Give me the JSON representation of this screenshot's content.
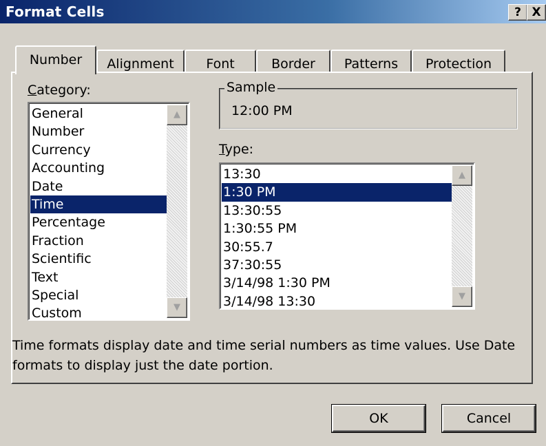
{
  "window": {
    "title": "Format Cells",
    "help_label": "?",
    "close_label": "X"
  },
  "tabs": [
    {
      "label": "Number",
      "active": true
    },
    {
      "label": "Alignment",
      "active": false
    },
    {
      "label": "Font",
      "active": false
    },
    {
      "label": "Border",
      "active": false
    },
    {
      "label": "Patterns",
      "active": false
    },
    {
      "label": "Protection",
      "active": false
    }
  ],
  "category": {
    "label_first": "C",
    "label_rest": "ategory:",
    "items": [
      "General",
      "Number",
      "Currency",
      "Accounting",
      "Date",
      "Time",
      "Percentage",
      "Fraction",
      "Scientific",
      "Text",
      "Special",
      "Custom"
    ],
    "selected": "Time"
  },
  "sample": {
    "label": "Sample",
    "value": "12:00 PM"
  },
  "type": {
    "label_first": "T",
    "label_rest": "ype:",
    "items": [
      "13:30",
      "1:30 PM",
      "13:30:55",
      "1:30:55 PM",
      "30:55.7",
      "37:30:55",
      "3/14/98 1:30 PM",
      "3/14/98 13:30"
    ],
    "selected": "1:30 PM"
  },
  "description": "Time formats display date and time serial numbers as time values.  Use Date formats to display just the date portion.",
  "buttons": {
    "ok_label": "OK",
    "cancel_label": "Cancel"
  },
  "icons": {
    "scroll_up": "scroll-up-arrow-icon",
    "scroll_down": "scroll-down-arrow-icon"
  }
}
